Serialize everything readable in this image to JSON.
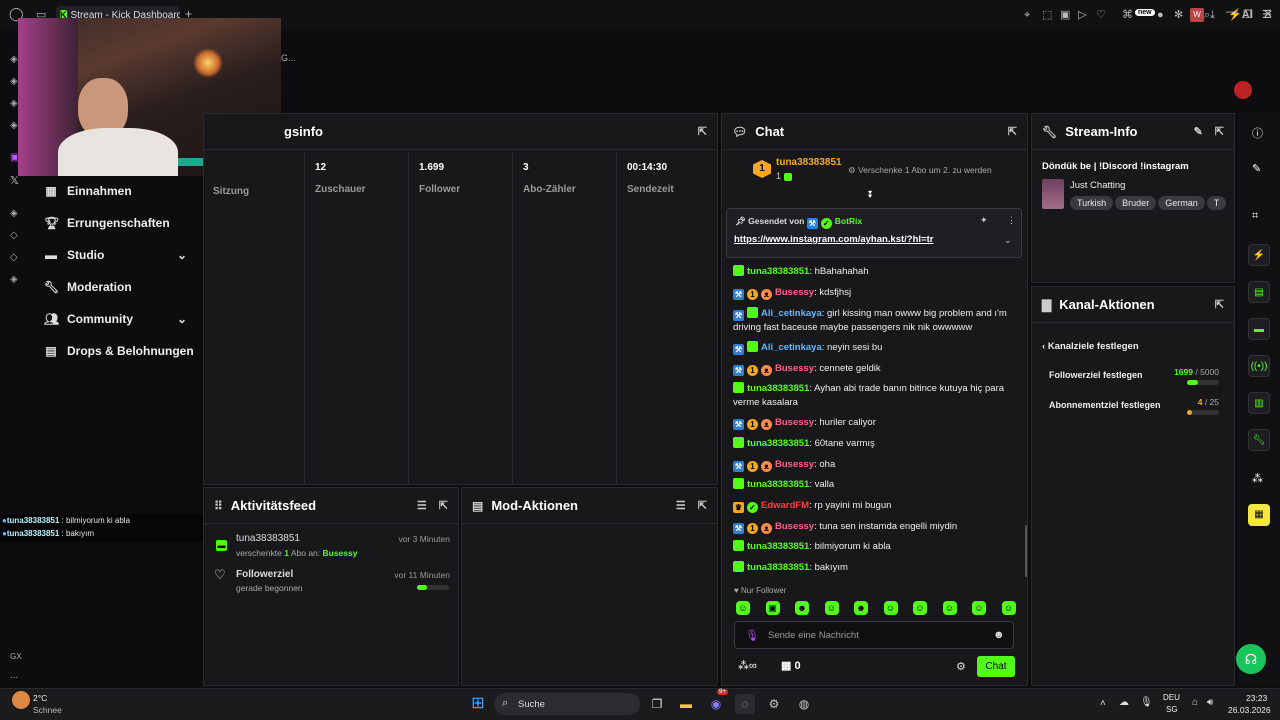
{
  "browser": {
    "tab_title": "Stream - Kick Dashboard",
    "new_tab": "+",
    "partial_url": "G...",
    "ext_badge": "new",
    "ext_letter": "W",
    "ai_label": "AI"
  },
  "sidebar": {
    "items": [
      {
        "label": "Einnahmen",
        "icon": "dollar-icon"
      },
      {
        "label": "Errungenschaften",
        "icon": "trophy-icon"
      },
      {
        "label": "Studio",
        "icon": "studio-icon"
      },
      {
        "label": "Moderation",
        "icon": "wrench-icon"
      },
      {
        "label": "Community",
        "icon": "community-icon"
      },
      {
        "label": "Drops & Belohnungen",
        "icon": "gift-icon"
      }
    ],
    "overlay_chat": [
      {
        "user": "tuna38383851",
        "text": " : bilmiyorum ki abla"
      },
      {
        "user": "tuna38383851",
        "text": " : bakıyım"
      }
    ],
    "gx": "GX",
    "more": "..."
  },
  "session": {
    "title_partial": "gsinfo",
    "stats": [
      {
        "value": "",
        "label": "Sitzung"
      },
      {
        "value": "12",
        "label": "Zuschauer"
      },
      {
        "value": "1.699",
        "label": "Follower"
      },
      {
        "value": "3",
        "label": "Abo-Zähler"
      },
      {
        "value": "00:14:30",
        "label": "Sendezeit"
      }
    ]
  },
  "activity": {
    "title": "Aktivitätsfeed",
    "items": [
      {
        "title": "tuna38383851",
        "time": "vor 3 Minuten",
        "sub_pre": "verschenkte ",
        "sub_num": "1",
        "sub_mid": " Abo an: ",
        "sub_user": "Busessy"
      },
      {
        "title": "Followerziel",
        "time": "vor 11 Minuten",
        "sub": "gerade begonnen"
      }
    ]
  },
  "mod": {
    "title": "Mod-Aktionen"
  },
  "chat": {
    "title": "Chat",
    "gift_user": "tuna38383851",
    "gift_count": "1",
    "gift_badge": "1",
    "gift_text": "Verschenke 1 Abo um 2. zu werden",
    "pinned_by_label": "Gesendet von",
    "pinned_by": "BotRix",
    "pinned_link": "https://www.instagram.com/ayhan.kst/?hl=tr",
    "messages": [
      {
        "user": "tuna38383851",
        "cls": "ug",
        "text": ": hBahahahah"
      },
      {
        "user": "Busessy",
        "cls": "up",
        "text": ": kdsfjhsj"
      },
      {
        "user": "Ali_cetinkaya",
        "cls": "ub",
        "text": ": girl kissing man owww big problem and ı'm driving fast baceuse maybe passengers nik nik owwwww"
      },
      {
        "user": "Ali_cetinkaya",
        "cls": "ub",
        "text": ": neyin sesi bu"
      },
      {
        "user": "Busessy",
        "cls": "up",
        "text": ": cennete geldik"
      },
      {
        "user": "tuna38383851",
        "cls": "ug",
        "text": ": Ayhan abi trade banın bitince kutuya hiç para verme kasalara"
      },
      {
        "user": "Busessy",
        "cls": "up",
        "text": ": huriler caliyor"
      },
      {
        "user": "tuna38383851",
        "cls": "ug",
        "text": ": 60tane varmış"
      },
      {
        "user": "Busessy",
        "cls": "up",
        "text": ": oha"
      },
      {
        "user": "tuna38383851",
        "cls": "ug",
        "text": ": valla"
      },
      {
        "user": "EdwardFM",
        "cls": "ur",
        "text": ": rp yayini mi bugun"
      },
      {
        "user": "Busessy",
        "cls": "up",
        "text": ": tuna sen instamda engelli miydin"
      },
      {
        "user": "tuna38383851",
        "cls": "ug",
        "text": ": bilmiyorum ki abla"
      },
      {
        "user": "tuna38383851",
        "cls": "ug",
        "text": ": bakıyım"
      }
    ],
    "followers_only": "Nur Follower",
    "input_placeholder": "Sende eine Nachricht",
    "infinity": "∞",
    "shop_count": "0",
    "send_label": "Chat"
  },
  "stream_info": {
    "title": "Stream-Info",
    "stream_title": "Döndük be | !Discord !instagram",
    "category": "Just Chatting",
    "tags": [
      "Turkish",
      "Bruder",
      "German",
      "T"
    ]
  },
  "channel_actions": {
    "title": "Kanal-Aktionen",
    "back_label": "Kanalziele festlegen",
    "goals": [
      {
        "label": "Followerziel festlegen",
        "current": "1699",
        "total": " / 5000",
        "progress": 0.34
      },
      {
        "label": "Abonnementziel festlegen",
        "current": "4",
        "total": " / 25",
        "progress": 0.16
      }
    ]
  },
  "taskbar": {
    "weather_temp": "2°C",
    "weather_desc": "Schnee",
    "search": "Suche",
    "lang": "DEU",
    "lang2": "SG",
    "time": "23:23",
    "date": "26.03.2026",
    "notif_badge": "9+"
  },
  "colors": {
    "accent": "#53fc18",
    "panel": "#18181b",
    "bg": "#0d0d0f"
  }
}
